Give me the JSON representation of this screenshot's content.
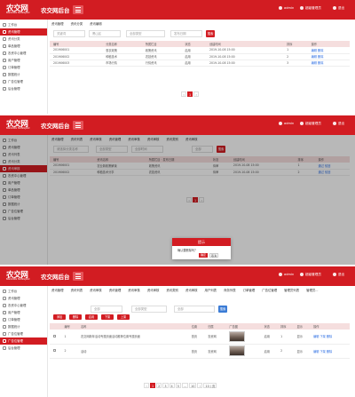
{
  "header": {
    "logo_text": "农交网",
    "logo_sub": "BAIGONG NONGJIAO",
    "title": "农交网后台",
    "user_name": "admin",
    "user_role": "超级管理员",
    "exit_label": "退出"
  },
  "panel1": {
    "sidebar": [
      {
        "label": "工作台",
        "active": false,
        "sub": false
      },
      {
        "label": "资讯管理",
        "active": true,
        "sub": false
      },
      {
        "label": "资讯分类",
        "active": false,
        "sub": true
      },
      {
        "label": "单品管理",
        "active": false,
        "sub": false
      },
      {
        "label": "农资中心管理",
        "active": false,
        "sub": false
      },
      {
        "label": "用户管理",
        "active": false,
        "sub": false
      },
      {
        "label": "订单管理",
        "active": false,
        "sub": false
      },
      {
        "label": "数据统计",
        "active": false,
        "sub": false
      },
      {
        "label": "广告位管理",
        "active": false,
        "sub": false
      },
      {
        "label": "后台管理",
        "active": false,
        "sub": false
      }
    ],
    "tabs": [
      "资讯管理",
      "资讯分类",
      "资讯编辑"
    ],
    "search": {
      "placeholder": "关键词",
      "region": "黑山区",
      "status": "全部类型",
      "date": "发布日期",
      "button": "搜索"
    },
    "table_headers": [
      "编号",
      "分类名称",
      "所属栏目",
      "状态",
      "创建时间",
      "排序",
      "操作"
    ],
    "rows": [
      [
        "201906001",
        "惠农政策",
        "政策资讯",
        "启用",
        "2019-10-08 15:00",
        "1",
        "编辑 删除"
      ],
      [
        "201906002",
        "种植技术",
        "农技资讯",
        "启用",
        "2019-10-08 15:00",
        "2",
        "编辑 删除"
      ],
      [
        "201906003",
        "市场行情",
        "行情资讯",
        "启用",
        "2019-10-08 15:00",
        "3",
        "编辑 删除"
      ]
    ],
    "pager": [
      "‹",
      "1",
      "›"
    ]
  },
  "panel2": {
    "sidebar": [
      {
        "label": "工作台",
        "active": false,
        "sub": false
      },
      {
        "label": "资讯管理",
        "active": false,
        "sub": false
      },
      {
        "label": "资讯列表",
        "active": false,
        "sub": true
      },
      {
        "label": "资讯分类",
        "active": false,
        "sub": true
      },
      {
        "label": "资讯审核",
        "active": true,
        "sub": true
      },
      {
        "label": "农资中心管理",
        "active": false,
        "sub": false
      },
      {
        "label": "用户管理",
        "active": false,
        "sub": false
      },
      {
        "label": "单品管理",
        "active": false,
        "sub": false
      },
      {
        "label": "订单管理",
        "active": false,
        "sub": false
      },
      {
        "label": "数据统计",
        "active": false,
        "sub": false
      },
      {
        "label": "广告位管理",
        "active": false,
        "sub": false
      },
      {
        "label": "后台管理",
        "active": false,
        "sub": false
      }
    ],
    "tabs": [
      "资讯管理",
      "资讯列表",
      "资讯审核",
      "资讯管理",
      "资讯审核",
      "资讯审核",
      "资讯类别",
      "资讯审核"
    ],
    "search": {
      "placeholder": "请选择分类名称",
      "region": "全部类型",
      "date": "全部时间",
      "status": "全部",
      "button": "搜索"
    },
    "table_headers": [
      "编号",
      "资讯名称",
      "所属栏目 · 发布日期",
      "状态",
      "创建时间",
      "排序",
      "操作"
    ],
    "rows": [
      [
        "201906001",
        "农业新政策解读",
        "政策资讯",
        "待审",
        "2019-10-08 15:00",
        "1",
        "通过 驳回"
      ],
      [
        "201906002",
        "种植技术分享",
        "农技资讯",
        "待审",
        "2019-10-08 15:00",
        "2",
        "通过 驳回"
      ]
    ],
    "pager": [
      "‹",
      "1",
      "›"
    ],
    "dialog": {
      "title": "提示",
      "message": "确认要删除吗？",
      "ok": "确定",
      "cancel": "取消"
    }
  },
  "panel3": {
    "sidebar": [
      {
        "label": "工作台",
        "active": false,
        "sub": false
      },
      {
        "label": "资讯管理",
        "active": false,
        "sub": false
      },
      {
        "label": "农资中心管理",
        "active": false,
        "sub": false
      },
      {
        "label": "用户管理",
        "active": false,
        "sub": false
      },
      {
        "label": "订单管理",
        "active": false,
        "sub": false
      },
      {
        "label": "数据统计",
        "active": false,
        "sub": false
      },
      {
        "label": "广告位管理",
        "active": false,
        "sub": false
      },
      {
        "label": "广告位管理",
        "active": true,
        "sub": false
      },
      {
        "label": "后台管理",
        "active": false,
        "sub": false
      }
    ],
    "tabs": [
      "资讯管理",
      "资讯列表",
      "资讯审核",
      "资讯管理",
      "资讯审核",
      "资讯审核",
      "资讯类别",
      "资讯审核",
      "用户列表",
      "商务列表",
      "订单管理",
      "广告位管理",
      "管理员列表",
      "管理员..."
    ],
    "filters": {
      "f1": "全部",
      "f2": "全部类型",
      "f3": "全部",
      "button": "搜索"
    },
    "actions": [
      "添加",
      "删除",
      "启用",
      "下架",
      "上架"
    ],
    "table_headers": [
      "",
      "编号",
      "名称",
      "位置",
      "归属",
      "广告图",
      "状态",
      "排序",
      "显示",
      "操作"
    ],
    "rows": [
      {
        "id": "1",
        "name": "农交网新年活动专题页面活动推荐位置专题页面",
        "pos": "首页",
        "owner": "农资网",
        "status": "启用",
        "sort": "1",
        "show": "显示",
        "ops": "编辑 下架 删除"
      },
      {
        "id": "2",
        "name": "活动",
        "pos": "首页",
        "owner": "农资网",
        "status": "启用",
        "sort": "2",
        "show": "显示",
        "ops": "编辑 下架 删除"
      }
    ],
    "pager": [
      "‹",
      "1",
      "2",
      "3",
      "4",
      "5",
      "...",
      "10",
      "›",
      "10 / 页"
    ]
  }
}
